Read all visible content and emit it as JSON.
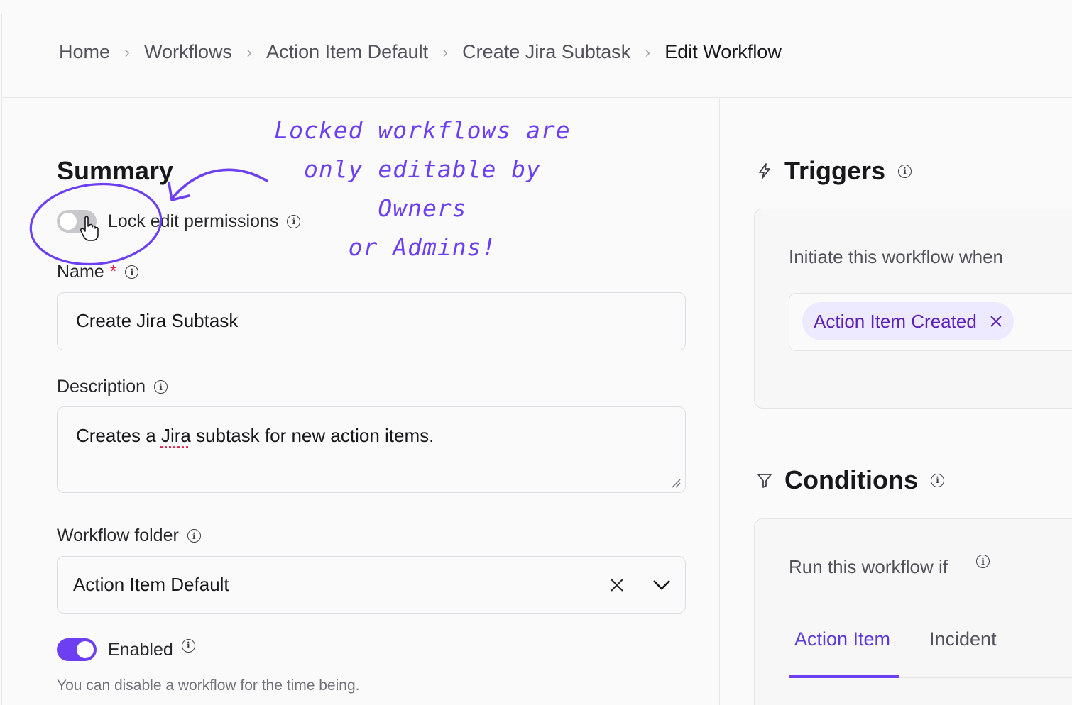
{
  "breadcrumb": {
    "items": [
      "Home",
      "Workflows",
      "Action Item Default",
      "Create Jira Subtask"
    ],
    "current": "Edit Workflow"
  },
  "summary": {
    "title": "Summary",
    "lock_label": "Lock edit permissions",
    "lock_enabled": false,
    "name_label": "Name",
    "required_mark": "*",
    "name_value": "Create Jira Subtask",
    "description_label": "Description",
    "description_prefix": "Creates a ",
    "description_flagged": "Jira",
    "description_suffix": " subtask for new action items.",
    "folder_label": "Workflow folder",
    "folder_value": "Action Item Default",
    "enabled_label": "Enabled",
    "enabled": true,
    "enabled_help": "You can disable a workflow for the time being."
  },
  "annotation": {
    "line1": "Locked workflows are",
    "line2": "only editable by Owners",
    "line3": "or Admins!"
  },
  "triggers": {
    "title": "Triggers",
    "prompt": "Initiate this workflow when",
    "chip": "Action Item Created"
  },
  "conditions": {
    "title": "Conditions",
    "prompt": "Run this workflow if",
    "tabs": [
      "Action Item",
      "Incident"
    ],
    "active_tab": "Action Item"
  },
  "colors": {
    "accent": "#6d3ff2",
    "chip_bg": "#ede9fe",
    "required": "#e11d48"
  },
  "icons": {
    "info": "info-icon",
    "triggers": "lightning-icon",
    "conditions": "filter-icon",
    "clear": "close-icon",
    "dropdown": "chevron-down-icon"
  }
}
